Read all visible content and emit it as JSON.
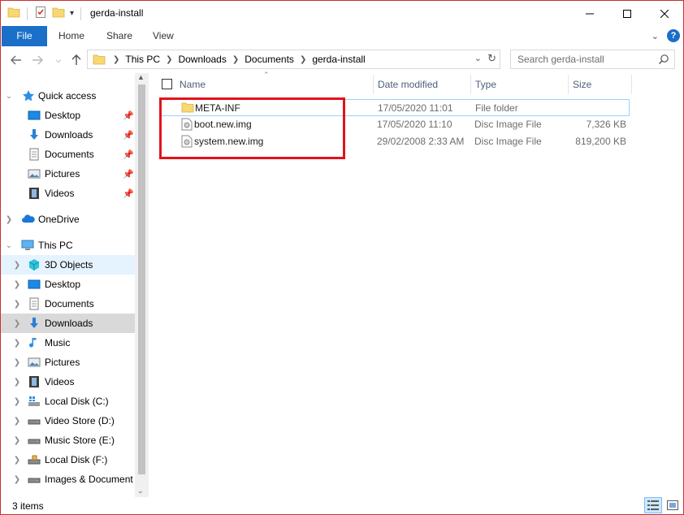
{
  "window": {
    "title": "gerda-install"
  },
  "ribbon": {
    "tabs": [
      "File",
      "Home",
      "Share",
      "View"
    ]
  },
  "address": {
    "crumbs": [
      "This PC",
      "Downloads",
      "Documents",
      "gerda-install"
    ]
  },
  "search": {
    "placeholder": "Search gerda-install"
  },
  "navpane": {
    "quick_access": "Quick access",
    "quick_items": [
      "Desktop",
      "Downloads",
      "Documents",
      "Pictures",
      "Videos"
    ],
    "onedrive": "OneDrive",
    "this_pc": "This PC",
    "pc_items": [
      "3D Objects",
      "Desktop",
      "Documents",
      "Downloads",
      "Music",
      "Pictures",
      "Videos",
      "Local Disk (C:)",
      "Video Store (D:)",
      "Music Store (E:)",
      "Local Disk (F:)",
      "Images & Document"
    ]
  },
  "columns": {
    "name": "Name",
    "date": "Date modified",
    "type": "Type",
    "size": "Size"
  },
  "files": [
    {
      "name": "META-INF",
      "date": "17/05/2020 11:01",
      "type": "File folder",
      "size": ""
    },
    {
      "name": "boot.new.img",
      "date": "17/05/2020 11:10",
      "type": "Disc Image File",
      "size": "7,326 KB"
    },
    {
      "name": "system.new.img",
      "date": "29/02/2008 2:33 AM",
      "type": "Disc Image File",
      "size": "819,200 KB"
    }
  ],
  "status": {
    "count": "3 items"
  },
  "colors": {
    "accent": "#1a6fc9",
    "highlight": "#e3121a",
    "folder": "#f8d775"
  }
}
